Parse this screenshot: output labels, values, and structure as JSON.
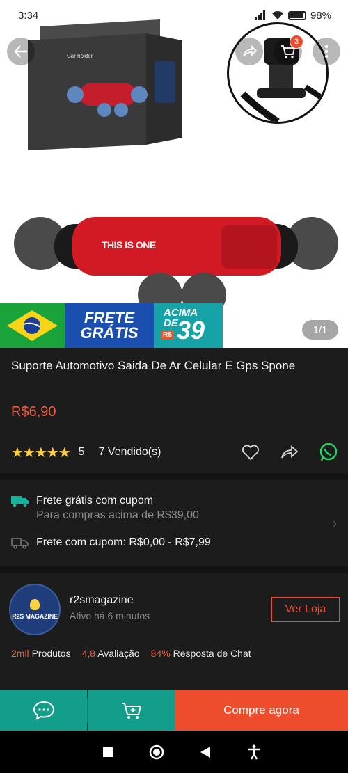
{
  "status_bar": {
    "time": "3:34",
    "battery": "98%"
  },
  "hero": {
    "cart_count": "3",
    "box_label": "Car holder",
    "product_print": "THIS IS ONE",
    "banner": {
      "frete_line1": "FRETE",
      "frete_line2": "GRÁTIS",
      "acima_line1": "ACIMA",
      "acima_line2": "DE",
      "currency": "R$",
      "amount": "39"
    },
    "page_indicator": "1/1"
  },
  "product": {
    "title": "Suporte Automotivo Saida De Ar Celular E Gps Spone",
    "price": "R$6,90",
    "rating_stars": "★★★★★",
    "rating": "5",
    "sold": "7 Vendido(s)"
  },
  "shipping": {
    "free_title": "Frete grátis com cupom",
    "free_sub": "Para compras acima de R$39,00",
    "coupon": "Frete com cupom: R$0,00 - R$7,99"
  },
  "shop": {
    "logo_text": "R2S MAGAZINE",
    "name": "r2smagazine",
    "status": "Ativo há 6 minutos",
    "visit_label": "Ver Loja",
    "stats": {
      "products_value": "2mil",
      "products_label": "Produtos",
      "rating_value": "4,8",
      "rating_label": "Avaliação",
      "chat_value": "84%",
      "chat_label": "Resposta de Chat"
    }
  },
  "actions": {
    "buy_now": "Compre agora"
  },
  "colors": {
    "brand": "#ee4d2d",
    "teal": "#139e8c",
    "price": "#f05d3f",
    "star": "#ffce3d",
    "whatsapp": "#25d366"
  }
}
